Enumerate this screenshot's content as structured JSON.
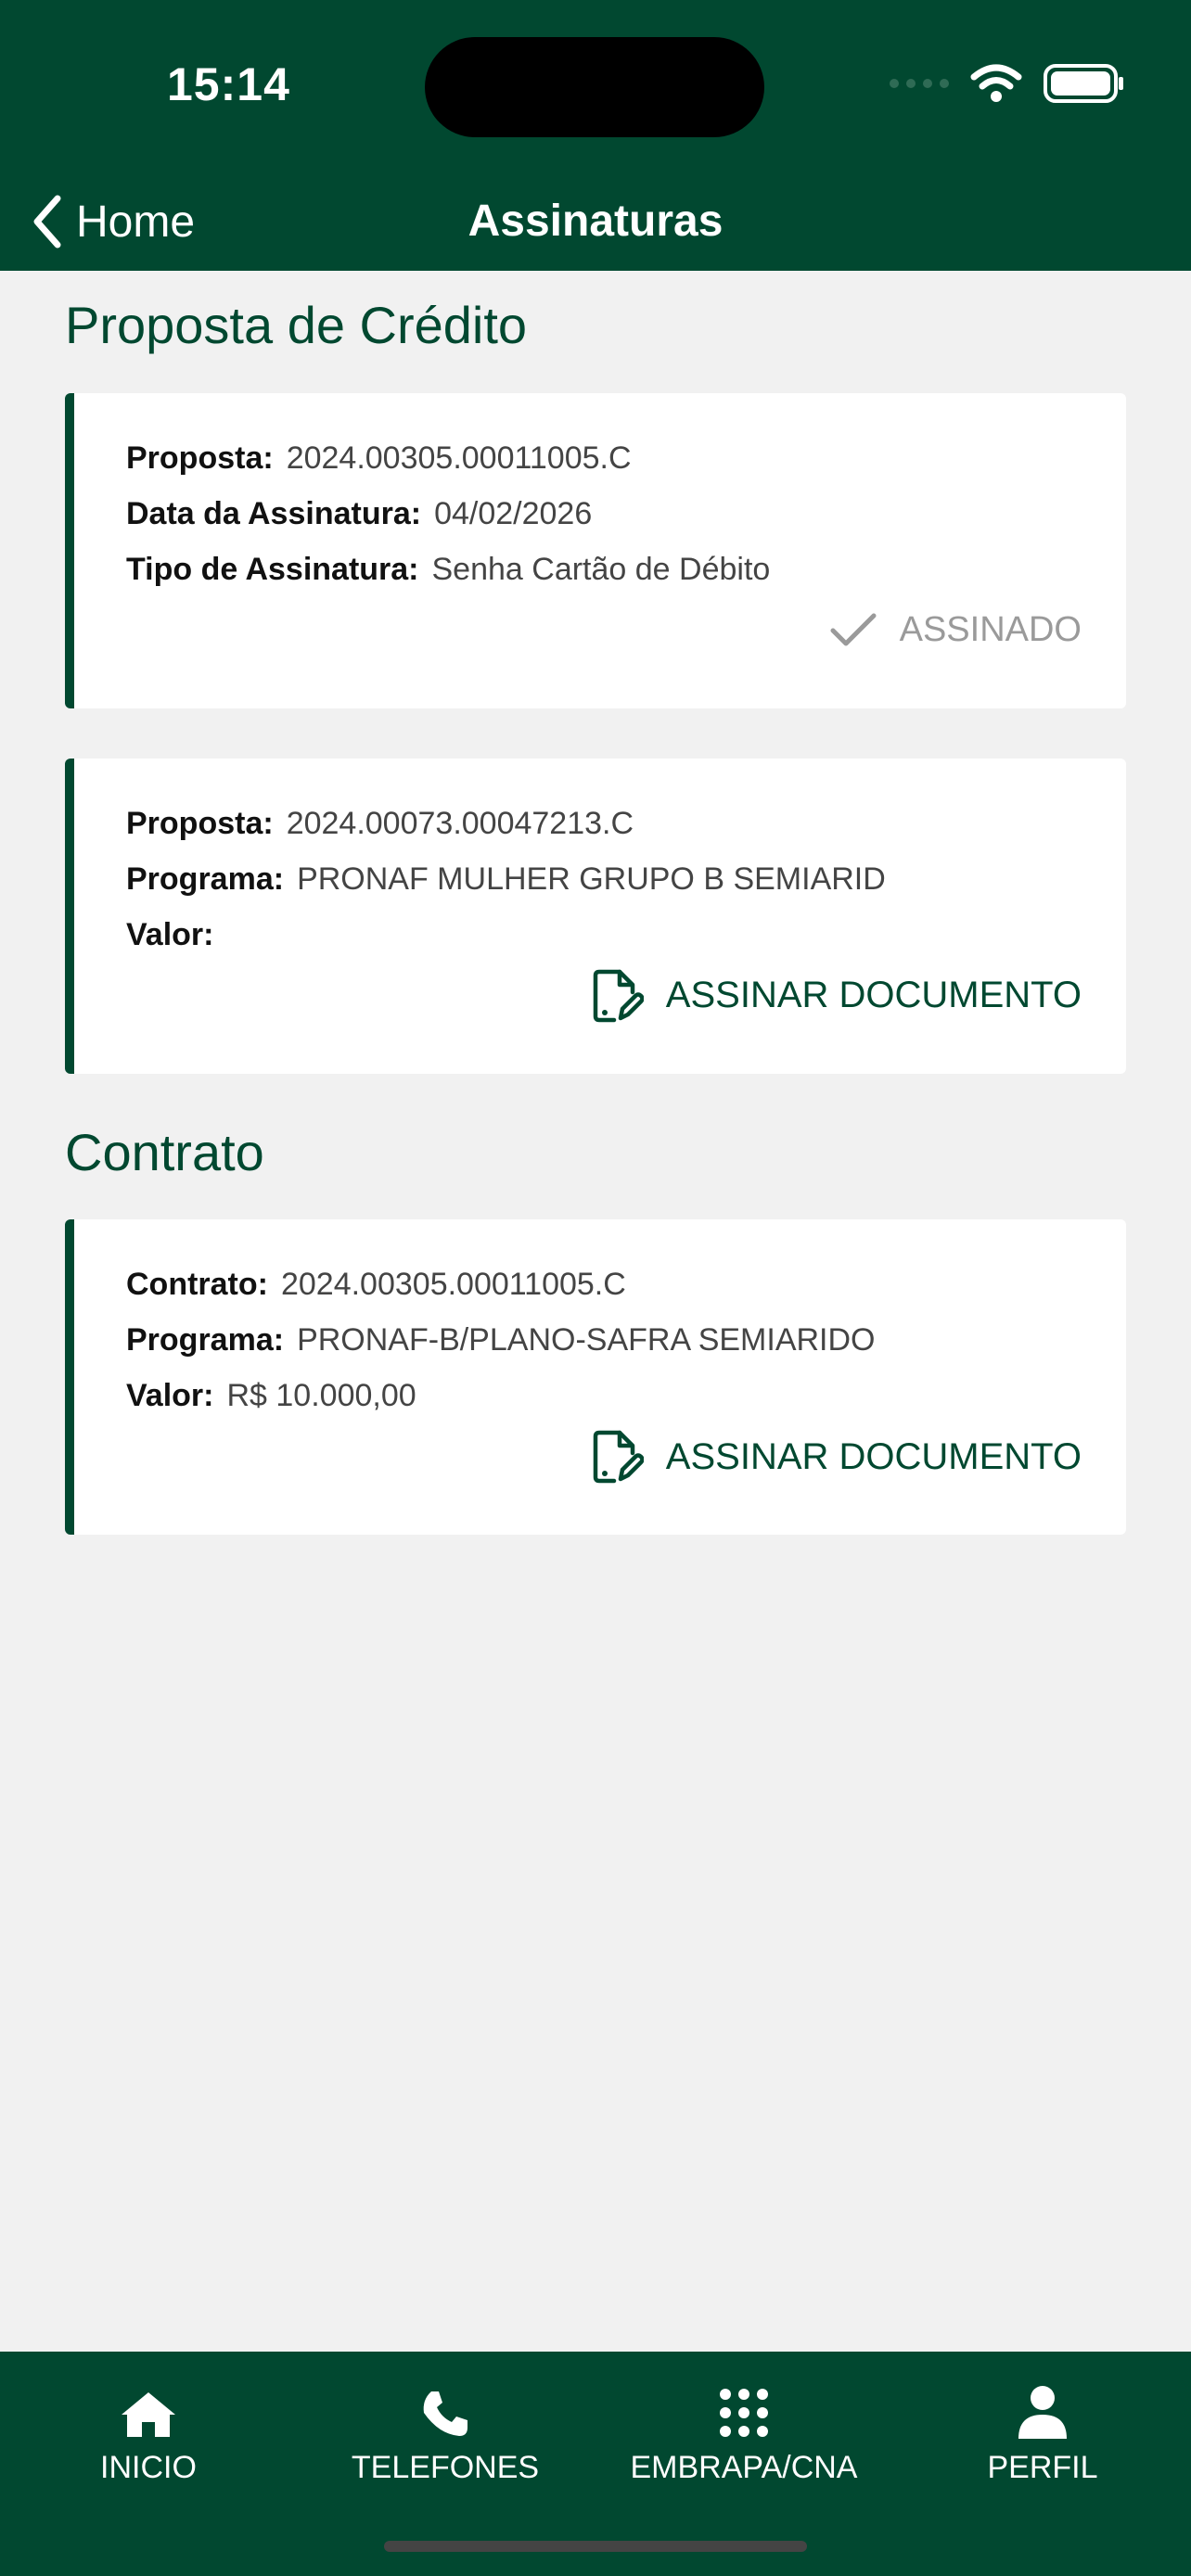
{
  "status_bar": {
    "time": "15:14"
  },
  "nav": {
    "back_label": "Home",
    "title": "Assinaturas"
  },
  "sections": {
    "proposta": {
      "title": "Proposta de Crédito",
      "cards": [
        {
          "rows": [
            {
              "label": "Proposta:",
              "value": "2024.00305.00011005.C"
            },
            {
              "label": "Data da Assinatura:",
              "value": "04/02/2026"
            },
            {
              "label": "Tipo de Assinatura:",
              "value": "Senha Cartão de Débito"
            }
          ],
          "status_label": "ASSINADO"
        },
        {
          "rows": [
            {
              "label": "Proposta:",
              "value": "2024.00073.00047213.C"
            },
            {
              "label": "Programa:",
              "value": "PRONAF MULHER GRUPO B SEMIARID"
            },
            {
              "label": "Valor:",
              "value": ""
            }
          ],
          "action_label": "ASSINAR DOCUMENTO"
        }
      ]
    },
    "contrato": {
      "title": "Contrato",
      "cards": [
        {
          "rows": [
            {
              "label": "Contrato:",
              "value": "2024.00305.00011005.C"
            },
            {
              "label": "Programa:",
              "value": "PRONAF-B/PLANO-SAFRA SEMIARIDO"
            },
            {
              "label": "Valor:",
              "value": "R$ 10.000,00"
            }
          ],
          "action_label": "ASSINAR DOCUMENTO"
        }
      ]
    }
  },
  "tabs": [
    {
      "label": "INICIO",
      "icon": "home-icon"
    },
    {
      "label": "TELEFONES",
      "icon": "phone-icon"
    },
    {
      "label": "EMBRAPA/CNA",
      "icon": "grid-icon"
    },
    {
      "label": "PERFIL",
      "icon": "user-icon"
    }
  ],
  "colors": {
    "brand_green": "#014830",
    "background": "#f1f1f1",
    "muted": "#9a9a9a"
  }
}
